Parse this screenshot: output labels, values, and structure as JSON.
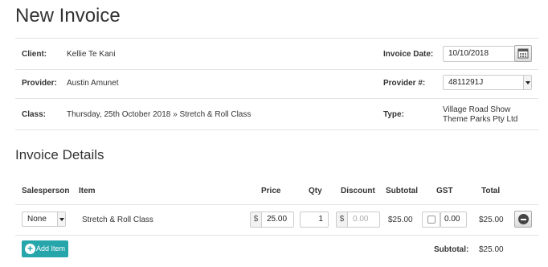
{
  "page": {
    "title": "New Invoice"
  },
  "client": {
    "label": "Client:",
    "value": "Kellie Te Kani"
  },
  "invoice_date": {
    "label": "Invoice Date:",
    "value": "10/10/2018"
  },
  "provider": {
    "label": "Provider:",
    "value": "Austin Amunet"
  },
  "provider_number": {
    "label": "Provider #:",
    "value": "4811291J"
  },
  "class": {
    "label": "Class:",
    "value": "Thursday, 25th October 2018 » Stretch & Roll Class"
  },
  "type": {
    "label": "Type:",
    "line1": "Village Road Show",
    "line2": "Theme Parks Pty Ltd"
  },
  "details": {
    "title": "Invoice Details",
    "headers": {
      "salesperson": "Salesperson",
      "item": "Item",
      "price": "Price",
      "qty": "Qty",
      "discount": "Discount",
      "subtotal": "Subtotal",
      "gst": "GST",
      "total": "Total"
    },
    "row": {
      "salesperson": "None",
      "item": "Stretch & Roll Class",
      "price_prefix": "$",
      "price": "25.00",
      "qty": "1",
      "discount_prefix": "$",
      "discount_placeholder": "0.00",
      "subtotal": "$25.00",
      "gst_checked": false,
      "gst": "0.00",
      "total": "$25.00"
    },
    "add_item_label": "Add Item",
    "footer_subtotal_label": "Subtotal:",
    "footer_subtotal_value": "$25.00"
  }
}
